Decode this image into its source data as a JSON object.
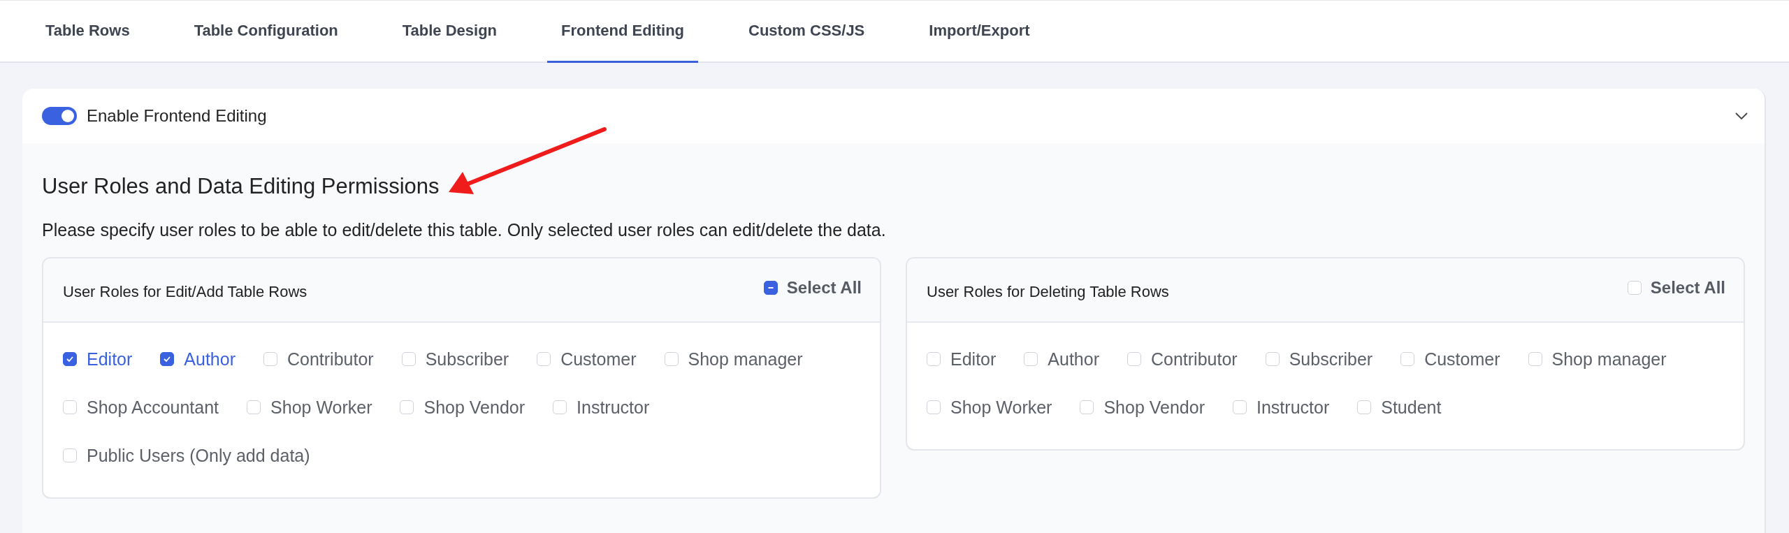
{
  "tabs": [
    {
      "label": "Table Rows",
      "selected": false
    },
    {
      "label": "Table Configuration",
      "selected": false
    },
    {
      "label": "Table Design",
      "selected": false
    },
    {
      "label": "Frontend Editing",
      "selected": true
    },
    {
      "label": "Custom CSS/JS",
      "selected": false
    },
    {
      "label": "Import/Export",
      "selected": false
    }
  ],
  "section": {
    "toggle": {
      "label": "Enable Frontend Editing",
      "on": true,
      "expanded": true
    },
    "heading": "User Roles and Data Editing Permissions",
    "description": "Please specify user roles to be able to edit/delete this table. Only selected user roles can edit/delete the data.",
    "panels": [
      {
        "title": "User Roles for Edit/Add Table Rows",
        "select_all": {
          "label": "Select All",
          "checked": true,
          "indeterminate": true
        },
        "roles": [
          {
            "label": "Editor",
            "checked": true
          },
          {
            "label": "Author",
            "checked": true
          },
          {
            "label": "Contributor",
            "checked": false
          },
          {
            "label": "Subscriber",
            "checked": false
          },
          {
            "label": "Customer",
            "checked": false
          },
          {
            "label": "Shop manager",
            "checked": false
          },
          {
            "label": "Shop Accountant",
            "checked": false
          },
          {
            "label": "Shop Worker",
            "checked": false
          },
          {
            "label": "Shop Vendor",
            "checked": false
          },
          {
            "label": "Instructor",
            "checked": false
          },
          {
            "label": "Public Users (Only add data)",
            "checked": false
          }
        ]
      },
      {
        "title": "User Roles for Deleting Table Rows",
        "select_all": {
          "label": "Select All",
          "checked": false,
          "indeterminate": false
        },
        "roles": [
          {
            "label": "Editor",
            "checked": false
          },
          {
            "label": "Author",
            "checked": false
          },
          {
            "label": "Contributor",
            "checked": false
          },
          {
            "label": "Subscriber",
            "checked": false
          },
          {
            "label": "Customer",
            "checked": false
          },
          {
            "label": "Shop manager",
            "checked": false
          },
          {
            "label": "Shop Worker",
            "checked": false
          },
          {
            "label": "Shop Vendor",
            "checked": false
          },
          {
            "label": "Instructor",
            "checked": false
          },
          {
            "label": "Student",
            "checked": false
          }
        ]
      }
    ]
  }
}
